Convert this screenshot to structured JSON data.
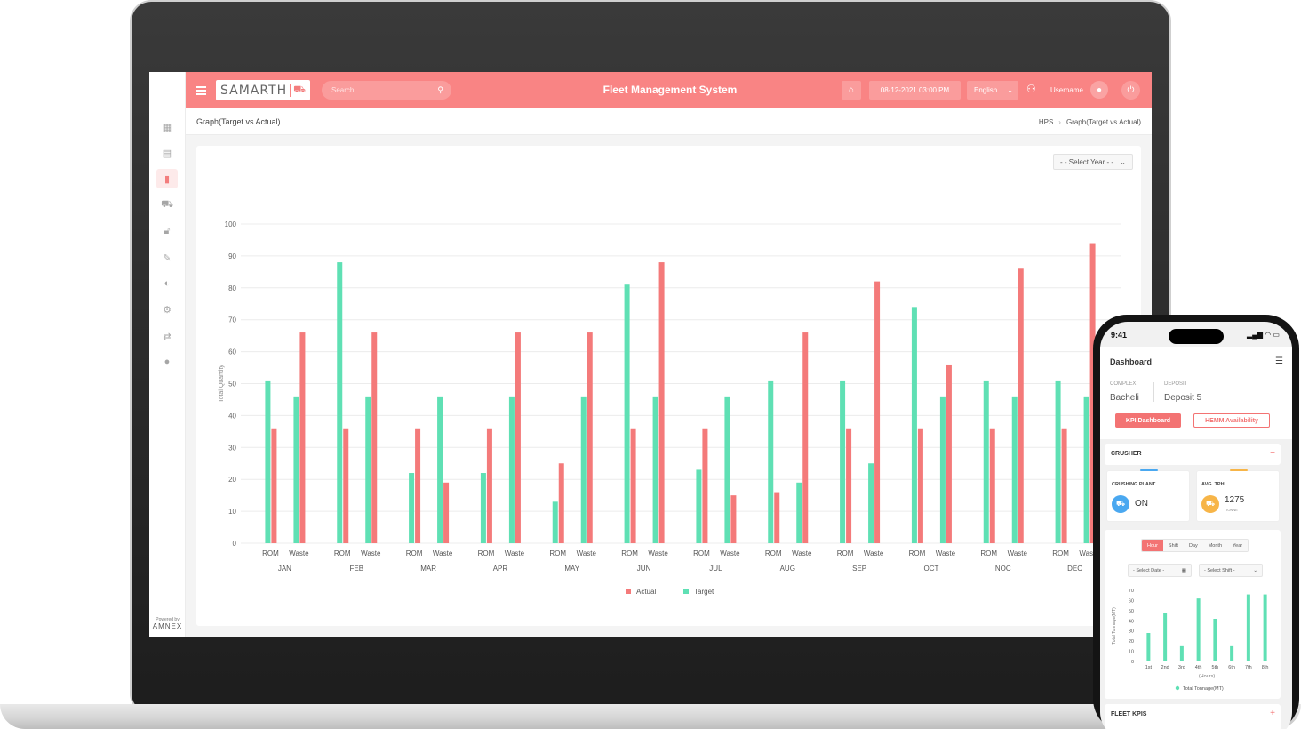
{
  "header": {
    "logo_text": "SAMARTH",
    "search_placeholder": "Search",
    "title": "Fleet Management System",
    "datetime": "08-12-2021  03:00 PM",
    "language": "English",
    "username": "Username"
  },
  "sidebar": {
    "items": [
      "dashboard",
      "reports",
      "graph",
      "fleet",
      "security",
      "edit",
      "globe",
      "settings",
      "transfer",
      "chat"
    ],
    "active": "graph",
    "powered_by": "Powered by",
    "powered_brand": "AMNEX"
  },
  "page": {
    "title": "Graph(Target vs Actual)",
    "breadcrumb": [
      "HPS",
      "Graph(Target vs Actual)"
    ],
    "year_select": "- - Select Year - -"
  },
  "chart_data": {
    "type": "bar",
    "ylabel": "Total Quantity",
    "ylim": [
      0,
      100
    ],
    "yticks": [
      0,
      10,
      20,
      30,
      40,
      50,
      60,
      70,
      80,
      90,
      100
    ],
    "months": [
      "JAN",
      "FEB",
      "MAR",
      "APR",
      "MAY",
      "JUN",
      "JUL",
      "AUG",
      "SEP",
      "OCT",
      "NOC",
      "DEC"
    ],
    "sub_categories": [
      "ROM",
      "Waste"
    ],
    "series": [
      {
        "name": "Target",
        "color": "#5fe0b4",
        "values": [
          [
            51,
            46
          ],
          [
            88,
            46
          ],
          [
            22,
            46
          ],
          [
            22,
            46
          ],
          [
            13,
            46
          ],
          [
            81,
            46
          ],
          [
            23,
            46
          ],
          [
            51,
            19
          ],
          [
            51,
            25
          ],
          [
            74,
            46
          ],
          [
            51,
            46
          ],
          [
            51,
            46
          ]
        ]
      },
      {
        "name": "Actual",
        "color": "#f47a7a",
        "values": [
          [
            36,
            66
          ],
          [
            36,
            66
          ],
          [
            36,
            19
          ],
          [
            36,
            66
          ],
          [
            25,
            66
          ],
          [
            36,
            88
          ],
          [
            36,
            15
          ],
          [
            16,
            66
          ],
          [
            36,
            82
          ],
          [
            36,
            56
          ],
          [
            36,
            86
          ],
          [
            36,
            94
          ]
        ]
      }
    ],
    "legend": [
      "Actual",
      "Target"
    ],
    "legend_position": "bottom"
  },
  "phone": {
    "time": "9:41",
    "status": "▂▄▆ ◠ ▭",
    "title": "Dashboard",
    "complex_label": "COMPLEX",
    "complex_value": "Bacheli",
    "deposit_label": "DEPOSIT",
    "deposit_value": "Deposit 5",
    "kpi_button": "KPI Dashboard",
    "hemm_button": "HEMM Availability",
    "crusher_title": "CRUSHER",
    "crushing_plant_label": "CRUSHING PLANT",
    "crushing_plant_value": "ON",
    "avg_tph_label": "AVG. TPH",
    "avg_tph_value": "1275",
    "avg_tph_unit": "TONNE",
    "tabs": [
      "Hour",
      "Shift",
      "Day",
      "Month",
      "Year"
    ],
    "select_date": "- Select Date -",
    "select_shift": "- Select Shift -",
    "fleet_kpis_title": "FLEET KPIS",
    "mini_chart": {
      "type": "bar",
      "ylabel": "Total Tonnage(MT)",
      "xlabel": "(Hours)",
      "yticks": [
        0,
        10,
        20,
        30,
        40,
        50,
        60,
        70
      ],
      "ylim": [
        0,
        70
      ],
      "categories": [
        "1st",
        "2nd",
        "3rd",
        "4th",
        "5th",
        "6th",
        "7th",
        "8th"
      ],
      "series": [
        {
          "name": "Total Tonnage(MT)",
          "values": [
            28,
            48,
            15,
            62,
            42,
            15,
            66,
            66
          ]
        }
      ],
      "color": "#5fe0b4"
    }
  }
}
